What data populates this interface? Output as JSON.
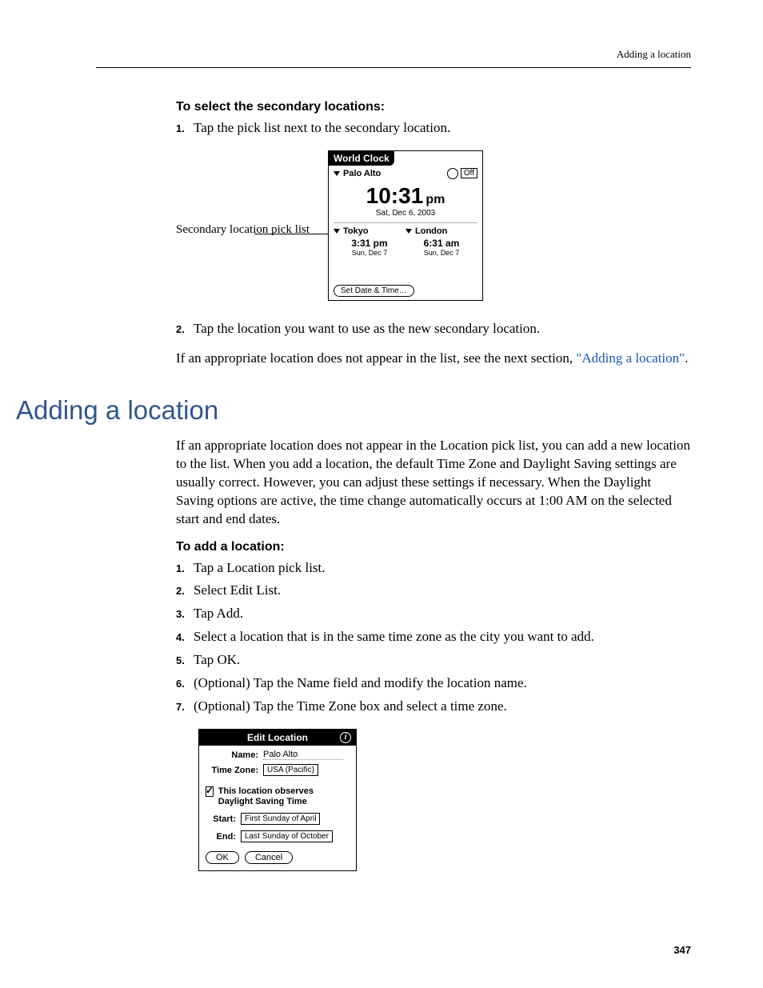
{
  "header": {
    "running": "Adding a location"
  },
  "sec1": {
    "title": "To select the secondary locations:",
    "steps": [
      "Tap the pick list next to the secondary location.",
      "Tap the location you want to use as the new secondary location."
    ],
    "callout": "Secondary location pick list",
    "device": {
      "title": "World Clock",
      "primary_city": "Palo Alto",
      "alarm": "Off",
      "time": "10:31",
      "ampm": "pm",
      "date": "Sat, Dec 6, 2003",
      "sec": [
        {
          "city": "Tokyo",
          "time": "3:31 pm",
          "date": "Sun, Dec 7"
        },
        {
          "city": "London",
          "time": "6:31 am",
          "date": "Sun, Dec 7"
        }
      ],
      "set_btn": "Set Date & Time…"
    },
    "para_pre": "If an appropriate location does not appear in the list, see the next section, ",
    "para_link": "\"Adding a location\"",
    "para_post": "."
  },
  "sec2": {
    "h1": "Adding a location",
    "intro": "If an appropriate location does not appear in the Location pick list, you can add a new location to the list. When you add a location, the default Time Zone and Daylight Saving settings are usually correct. However, you can adjust these settings if necessary. When the Daylight Saving options are active, the time change automatically occurs at 1:00 AM on the selected start and end dates.",
    "sub": "To add a location:",
    "steps": [
      "Tap a Location pick list.",
      "Select Edit List.",
      "Tap Add.",
      "Select a location that is in the same time zone as the city you want to add.",
      "Tap OK.",
      "(Optional) Tap the Name field and modify the location name.",
      "(Optional) Tap the Time Zone box and select a time zone."
    ],
    "dialog": {
      "title": "Edit Location",
      "name_label": "Name:",
      "name_value": "Palo Alto",
      "tz_label": "Time Zone:",
      "tz_value": "USA (Pacific)",
      "dst_text": "This location observes Daylight Saving Time",
      "start_label": "Start:",
      "start_value": "First Sunday of April",
      "end_label": "End:",
      "end_value": "Last Sunday of October",
      "ok": "OK",
      "cancel": "Cancel"
    }
  },
  "page_number": "347"
}
